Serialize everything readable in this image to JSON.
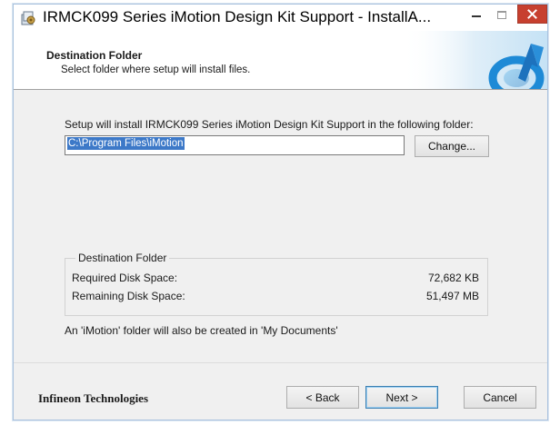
{
  "window": {
    "title": "IRMCK099 Series iMotion Design Kit Support - InstallA...",
    "icon": "installer-icon",
    "close_color": "#c7402f"
  },
  "header": {
    "title": "Destination Folder",
    "subtitle": "Select folder where setup will install files."
  },
  "body": {
    "intro": "Setup will install IRMCK099 Series iMotion Design Kit Support in the following folder:",
    "path_value": "C:\\Program Files\\iMotion",
    "change_label": "Change...",
    "disk": {
      "group_title": "Destination Folder",
      "required_label": "Required Disk Space:",
      "required_value": "72,682 KB",
      "remaining_label": "Remaining Disk Space:",
      "remaining_value": "51,497 MB"
    },
    "note": "An 'iMotion' folder will also be created in 'My Documents'"
  },
  "footer": {
    "company": "Infineon Technologies",
    "back_label": "< Back",
    "next_label": "Next >",
    "cancel_label": "Cancel"
  },
  "colors": {
    "selection": "#3d79c8",
    "dialog_bg": "#f0f0f0",
    "accent_blue": "#1e8ad6"
  }
}
